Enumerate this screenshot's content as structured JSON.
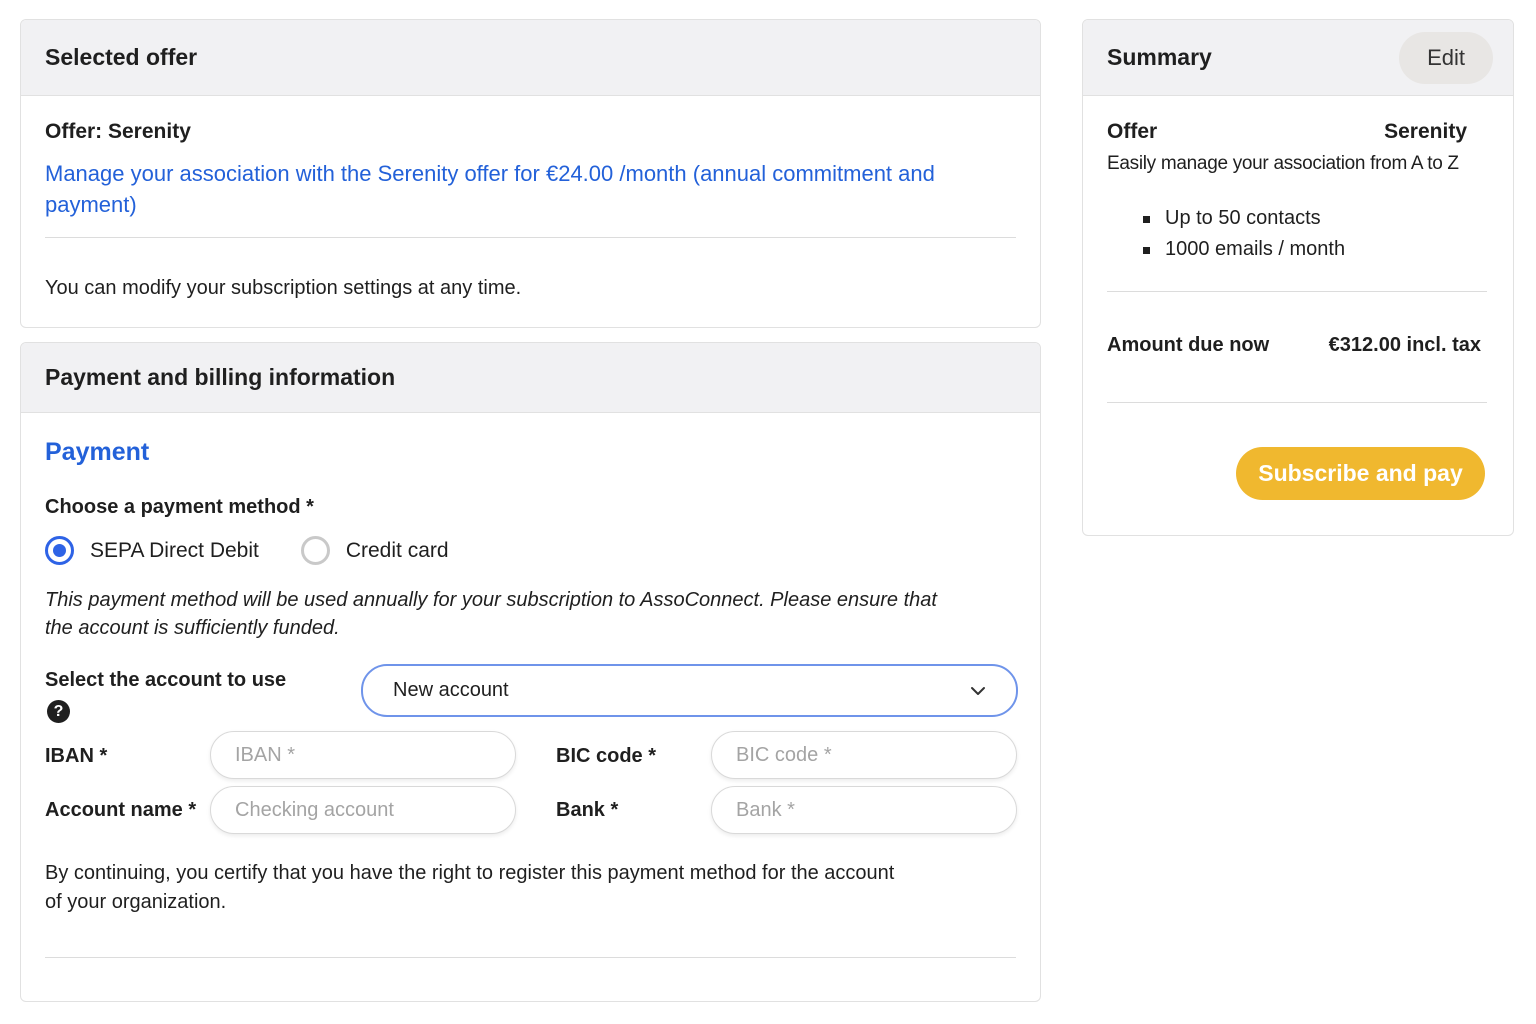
{
  "offer_card": {
    "header": "Selected offer",
    "offer_title": "Offer: Serenity",
    "offer_description": "Manage your association with the Serenity offer for €24.00 /month (annual commitment and payment)",
    "note": "You can modify your subscription settings at any time."
  },
  "payment_card": {
    "header": "Payment and billing information",
    "section_title": "Payment",
    "method_label": "Choose a payment method *",
    "methods": [
      {
        "label": "SEPA Direct Debit",
        "selected": true
      },
      {
        "label": "Credit card",
        "selected": false
      }
    ],
    "method_note": "This payment method will be used annually for your subscription to AssoConnect. Please ensure that the account is sufficiently funded.",
    "account_label": "Select the account to use",
    "help_icon": "question-circle-icon",
    "account_select_value": "New account",
    "fields": {
      "iban_label": "IBAN *",
      "iban_placeholder": "IBAN *",
      "bic_label": "BIC code *",
      "bic_placeholder": "BIC code *",
      "account_name_label": "Account name *",
      "account_name_placeholder": "Checking account",
      "bank_label": "Bank *",
      "bank_placeholder": "Bank *"
    },
    "certify_text": "By continuing, you certify that you have the right to register this payment method for the account of your organization."
  },
  "summary": {
    "header": "Summary",
    "edit_label": "Edit",
    "offer_label": "Offer",
    "offer_value": "Serenity",
    "tagline": "Easily manage your association from A to Z",
    "features": [
      "Up to 50 contacts",
      "1000 emails / month"
    ],
    "amount_label": "Amount due now",
    "amount_value": "€312.00 incl. tax",
    "subscribe_label": "Subscribe and pay"
  },
  "colors": {
    "accent_blue": "#2361d9",
    "cta_yellow": "#f0b82f",
    "header_bg": "#f1f1f3"
  }
}
